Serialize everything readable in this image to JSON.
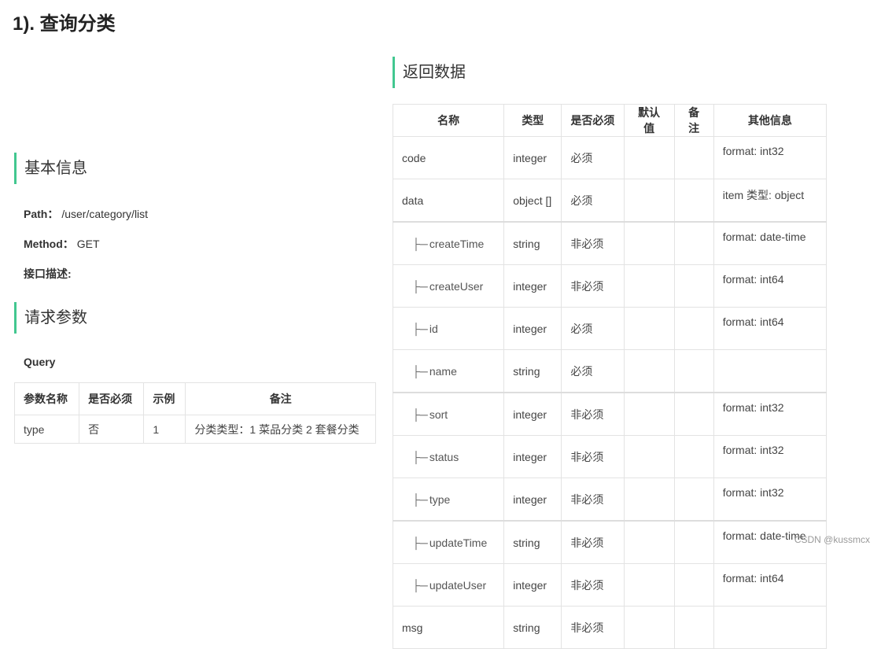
{
  "page_title": "1). 查询分类",
  "sections": {
    "basic_info": "基本信息",
    "request_params": "请求参数",
    "response_data": "返回数据"
  },
  "basic": {
    "path_label": "Path：",
    "path_value": "/user/category/list",
    "method_label": "Method：",
    "method_value": "GET",
    "desc_label": "接口描述:"
  },
  "query_label": "Query",
  "param_table": {
    "headers": [
      "参数名称",
      "是否必须",
      "示例",
      "备注"
    ],
    "rows": [
      [
        "type",
        "否",
        "1",
        "分类类型：1 菜品分类 2 套餐分类"
      ]
    ]
  },
  "resp_table": {
    "headers": [
      "名称",
      "类型",
      "是否必须",
      "默认值",
      "备注",
      "其他信息"
    ],
    "rows": [
      {
        "name": "code",
        "child": false,
        "type": "integer",
        "required": "必须",
        "default": "",
        "note": "",
        "info": "format: int32"
      },
      {
        "name": "data",
        "child": false,
        "type": "object []",
        "required": "必须",
        "default": "",
        "note": "",
        "info": "item 类型: object"
      },
      {
        "name": "createTime",
        "child": true,
        "type": "string",
        "required": "非必须",
        "default": "",
        "note": "",
        "info": "format: date-time"
      },
      {
        "name": "createUser",
        "child": true,
        "type": "integer",
        "required": "非必须",
        "default": "",
        "note": "",
        "info": "format: int64"
      },
      {
        "name": "id",
        "child": true,
        "type": "integer",
        "required": "必须",
        "default": "",
        "note": "",
        "info": "format: int64"
      },
      {
        "name": "name",
        "child": true,
        "type": "string",
        "required": "必须",
        "default": "",
        "note": "",
        "info": ""
      },
      {
        "name": "sort",
        "child": true,
        "type": "integer",
        "required": "非必须",
        "default": "",
        "note": "",
        "info": "format: int32"
      },
      {
        "name": "status",
        "child": true,
        "type": "integer",
        "required": "非必须",
        "default": "",
        "note": "",
        "info": "format: int32"
      },
      {
        "name": "type",
        "child": true,
        "type": "integer",
        "required": "非必须",
        "default": "",
        "note": "",
        "info": "format: int32"
      },
      {
        "name": "updateTime",
        "child": true,
        "type": "string",
        "required": "非必须",
        "default": "",
        "note": "",
        "info": "format: date-time"
      },
      {
        "name": "updateUser",
        "child": true,
        "type": "integer",
        "required": "非必须",
        "default": "",
        "note": "",
        "info": "format: int64"
      },
      {
        "name": "msg",
        "child": false,
        "type": "string",
        "required": "非必须",
        "default": "",
        "note": "",
        "info": ""
      }
    ]
  },
  "tree_branch": "├─",
  "watermark": "CSDN @kussmcx",
  "colors": {
    "accent": "#42c790",
    "border": "#e3e3e3"
  }
}
